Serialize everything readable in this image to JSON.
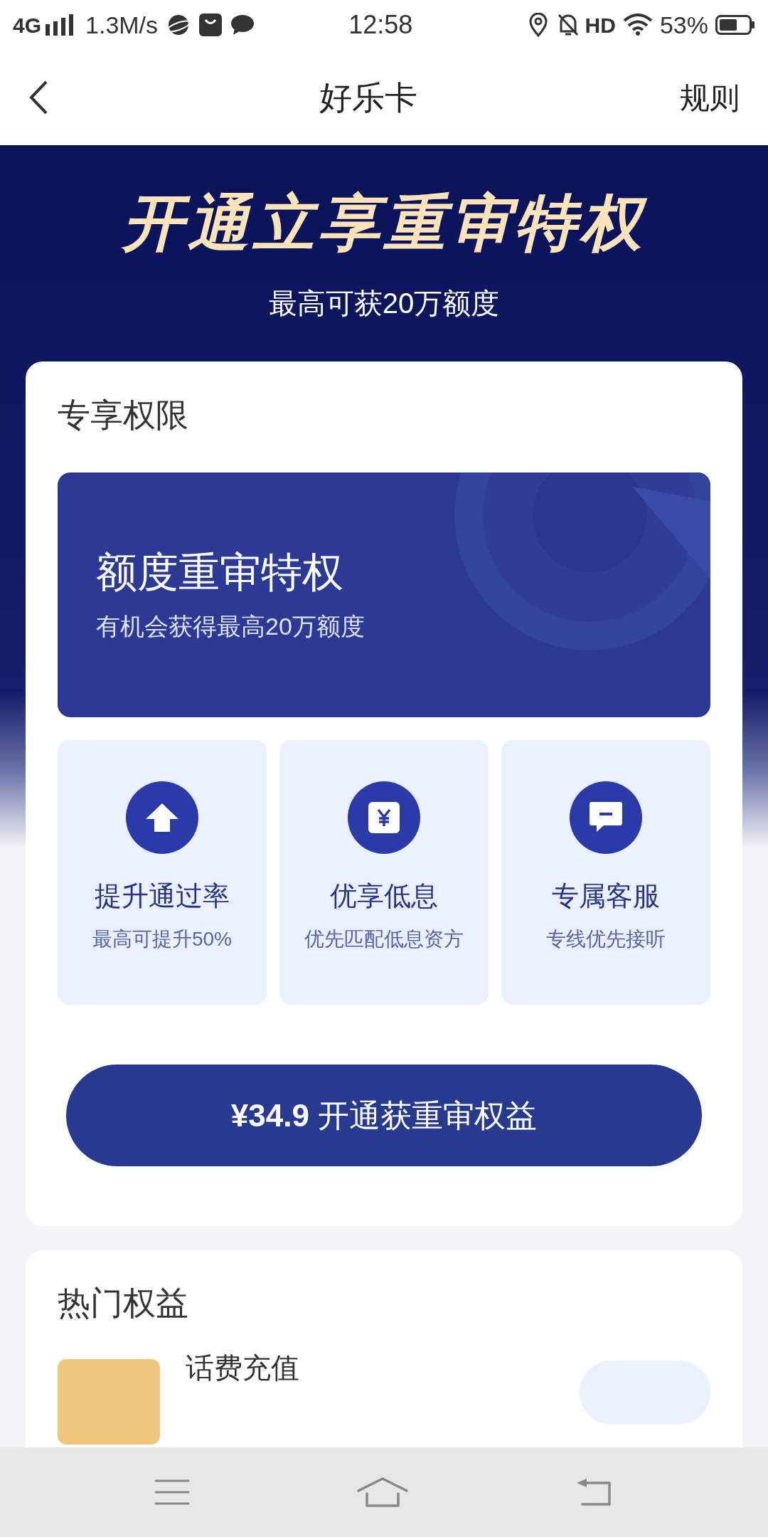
{
  "status_bar": {
    "network": "4G",
    "speed": "1.3M/s",
    "time": "12:58",
    "hd": "HD",
    "battery": "53%"
  },
  "nav": {
    "title": "好乐卡",
    "action": "规则"
  },
  "hero": {
    "title": "开通立享重审特权",
    "subtitle": "最高可获20万额度"
  },
  "privileges": {
    "heading": "专享权限",
    "banner": {
      "title": "额度重审特权",
      "subtitle": "有机会获得最高20万额度"
    },
    "features": [
      {
        "kind": "upgrade",
        "title": "提升通过率",
        "subtitle": "最高可提升50%"
      },
      {
        "kind": "rate",
        "title": "优享低息",
        "subtitle": "优先匹配低息资方"
      },
      {
        "kind": "service",
        "title": "专属客服",
        "subtitle": "专线优先接听"
      }
    ],
    "cta": "**¥34.9** 开通获重审权益"
  },
  "hot": {
    "heading": "热门权益",
    "items": [
      {
        "title": "话费充值"
      }
    ]
  }
}
